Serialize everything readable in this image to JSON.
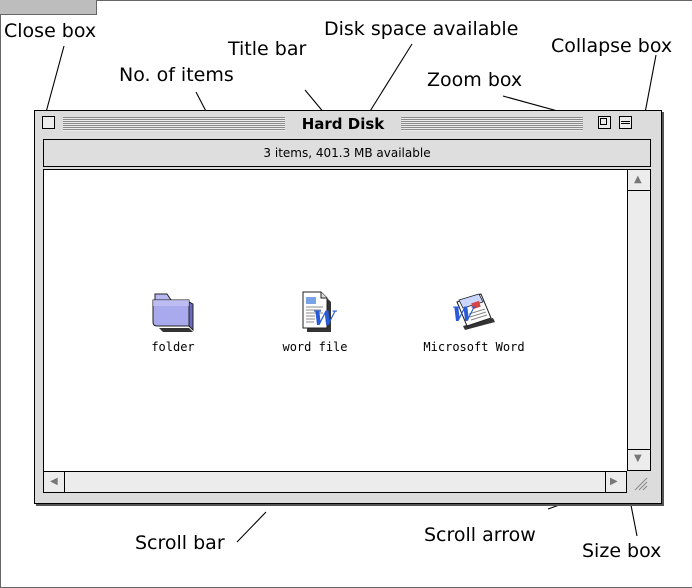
{
  "labels": {
    "close_box": "Close box",
    "title_bar": "Title bar",
    "disk_space": "Disk space available",
    "collapse_box": "Collapse box",
    "no_items": "No. of items",
    "zoom_box": "Zoom box",
    "file_icon": "File icon",
    "folder_icon": "Folder icon",
    "application_icon": "Application icon",
    "scroll_bar": "Scroll bar",
    "scroll_arrow": "Scroll arrow",
    "size_box": "Size box"
  },
  "window": {
    "title": "Hard Disk",
    "info": "3 items, 401.3 MB available"
  },
  "items": [
    {
      "name": "folder",
      "icon": "folder-icon"
    },
    {
      "name": "word file",
      "icon": "word-document-icon"
    },
    {
      "name": "Microsoft Word",
      "icon": "microsoft-word-application-icon"
    }
  ],
  "colors": {
    "folder": "#a9a9ee",
    "window_chrome": "#dcdcdc",
    "word_blue": "#2a5bd7"
  }
}
